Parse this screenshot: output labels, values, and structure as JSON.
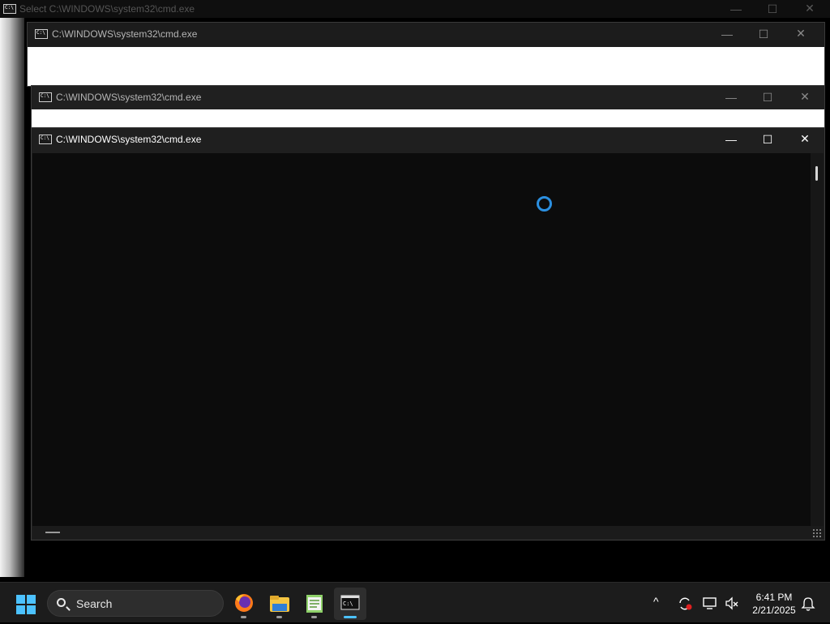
{
  "windows": {
    "back": {
      "title": "Select C:\\WINDOWS\\system32\\cmd.exe"
    },
    "first": {
      "title": "C:\\WINDOWS\\system32\\cmd.exe"
    },
    "second": {
      "title": "C:\\WINDOWS\\system32\\cmd.exe"
    },
    "active": {
      "title": "C:\\WINDOWS\\system32\\cmd.exe"
    }
  },
  "controls": {
    "minimize": "—",
    "maximize": "☐",
    "close": "✕"
  },
  "taskbar": {
    "search_label": "Search",
    "apps": [
      "firefox-icon",
      "file-explorer-icon",
      "notepad-icon",
      "terminal-icon"
    ],
    "accent_color": "#4cc2ff",
    "tray": {
      "chevron": "^"
    },
    "clock": {
      "time": "6:41 PM",
      "date": "2/21/2025"
    }
  }
}
